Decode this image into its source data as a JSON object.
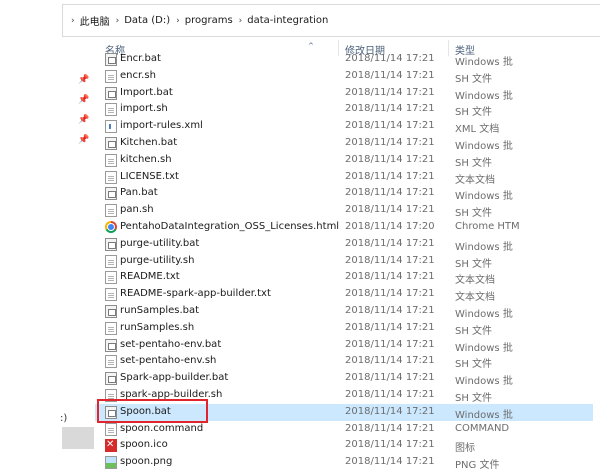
{
  "breadcrumb": {
    "items": [
      "此电脑",
      "Data (D:)",
      "programs",
      "data-integration"
    ]
  },
  "columns": {
    "name": "名称",
    "date": "修改日期",
    "type": "类型"
  },
  "left_pane": {
    "partial_label": ":)"
  },
  "files": [
    {
      "name": "Encr.bat",
      "date": "2018/11/14 17:21",
      "type": "Windows 批",
      "icon": "bat"
    },
    {
      "name": "encr.sh",
      "date": "2018/11/14 17:21",
      "type": "SH 文件",
      "icon": "doc"
    },
    {
      "name": "Import.bat",
      "date": "2018/11/14 17:21",
      "type": "Windows 批",
      "icon": "bat"
    },
    {
      "name": "import.sh",
      "date": "2018/11/14 17:21",
      "type": "SH 文件",
      "icon": "doc"
    },
    {
      "name": "import-rules.xml",
      "date": "2018/11/14 17:21",
      "type": "XML 文档",
      "icon": "xml"
    },
    {
      "name": "Kitchen.bat",
      "date": "2018/11/14 17:21",
      "type": "Windows 批",
      "icon": "bat"
    },
    {
      "name": "kitchen.sh",
      "date": "2018/11/14 17:21",
      "type": "SH 文件",
      "icon": "doc"
    },
    {
      "name": "LICENSE.txt",
      "date": "2018/11/14 17:21",
      "type": "文本文档",
      "icon": "doc"
    },
    {
      "name": "Pan.bat",
      "date": "2018/11/14 17:21",
      "type": "Windows 批",
      "icon": "bat"
    },
    {
      "name": "pan.sh",
      "date": "2018/11/14 17:21",
      "type": "SH 文件",
      "icon": "doc"
    },
    {
      "name": "PentahoDataIntegration_OSS_Licenses.html",
      "date": "2018/11/14 17:20",
      "type": "Chrome HTM",
      "icon": "chrome"
    },
    {
      "name": "purge-utility.bat",
      "date": "2018/11/14 17:21",
      "type": "Windows 批",
      "icon": "bat"
    },
    {
      "name": "purge-utility.sh",
      "date": "2018/11/14 17:21",
      "type": "SH 文件",
      "icon": "doc"
    },
    {
      "name": "README.txt",
      "date": "2018/11/14 17:21",
      "type": "文本文档",
      "icon": "doc"
    },
    {
      "name": "README-spark-app-builder.txt",
      "date": "2018/11/14 17:21",
      "type": "文本文档",
      "icon": "doc"
    },
    {
      "name": "runSamples.bat",
      "date": "2018/11/14 17:21",
      "type": "Windows 批",
      "icon": "bat"
    },
    {
      "name": "runSamples.sh",
      "date": "2018/11/14 17:21",
      "type": "SH 文件",
      "icon": "doc"
    },
    {
      "name": "set-pentaho-env.bat",
      "date": "2018/11/14 17:21",
      "type": "Windows 批",
      "icon": "bat"
    },
    {
      "name": "set-pentaho-env.sh",
      "date": "2018/11/14 17:21",
      "type": "SH 文件",
      "icon": "doc"
    },
    {
      "name": "Spark-app-builder.bat",
      "date": "2018/11/14 17:21",
      "type": "Windows 批",
      "icon": "bat"
    },
    {
      "name": "spark-app-builder.sh",
      "date": "2018/11/14 17:21",
      "type": "SH 文件",
      "icon": "doc"
    },
    {
      "name": "Spoon.bat",
      "date": "2018/11/14 17:21",
      "type": "Windows 批",
      "icon": "bat",
      "selected": true
    },
    {
      "name": "spoon.command",
      "date": "2018/11/14 17:21",
      "type": "COMMAND",
      "icon": "doc"
    },
    {
      "name": "spoon.ico",
      "date": "2018/11/14 17:21",
      "type": "图标",
      "icon": "ico"
    },
    {
      "name": "spoon.png",
      "date": "2018/11/14 17:21",
      "type": "PNG 文件",
      "icon": "png"
    }
  ]
}
